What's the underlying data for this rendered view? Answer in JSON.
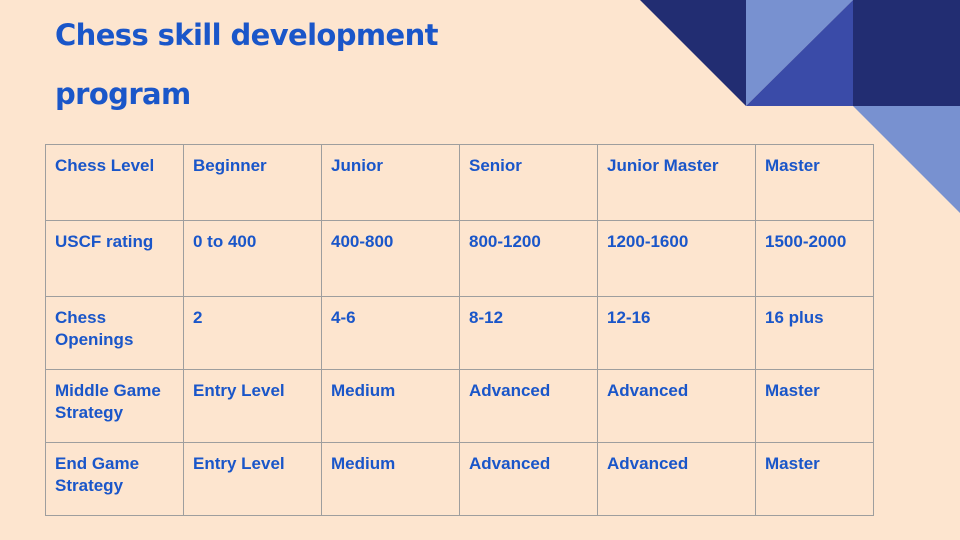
{
  "slide": {
    "title": "Chess skill development program",
    "colors": {
      "background": "#fde5cf",
      "title_text": "#1a56c9",
      "table_text": "#1a56c9",
      "table_border": "#9e9e9e",
      "deco_dark": "#222d72",
      "deco_medium": "#3a4ba8",
      "deco_light": "#7891d0"
    }
  },
  "table": {
    "rows": [
      {
        "label": "Chess Level",
        "cells": [
          "Beginner",
          "Junior",
          "Senior",
          "Junior Master",
          "Master"
        ]
      },
      {
        "label": "USCF rating",
        "cells": [
          "0 to 400",
          "400-800",
          "800-1200",
          "1200-1600",
          "1500-2000"
        ]
      },
      {
        "label": "Chess Openings",
        "cells": [
          "2",
          "4-6",
          "8-12",
          "12-16",
          "16 plus"
        ]
      },
      {
        "label": "Middle Game Strategy",
        "cells": [
          "Entry Level",
          "Medium",
          "Advanced",
          "Advanced",
          "Master"
        ]
      },
      {
        "label": "End Game Strategy",
        "cells": [
          "Entry Level",
          "Medium",
          "Advanced",
          "Advanced",
          "Master"
        ]
      }
    ]
  }
}
